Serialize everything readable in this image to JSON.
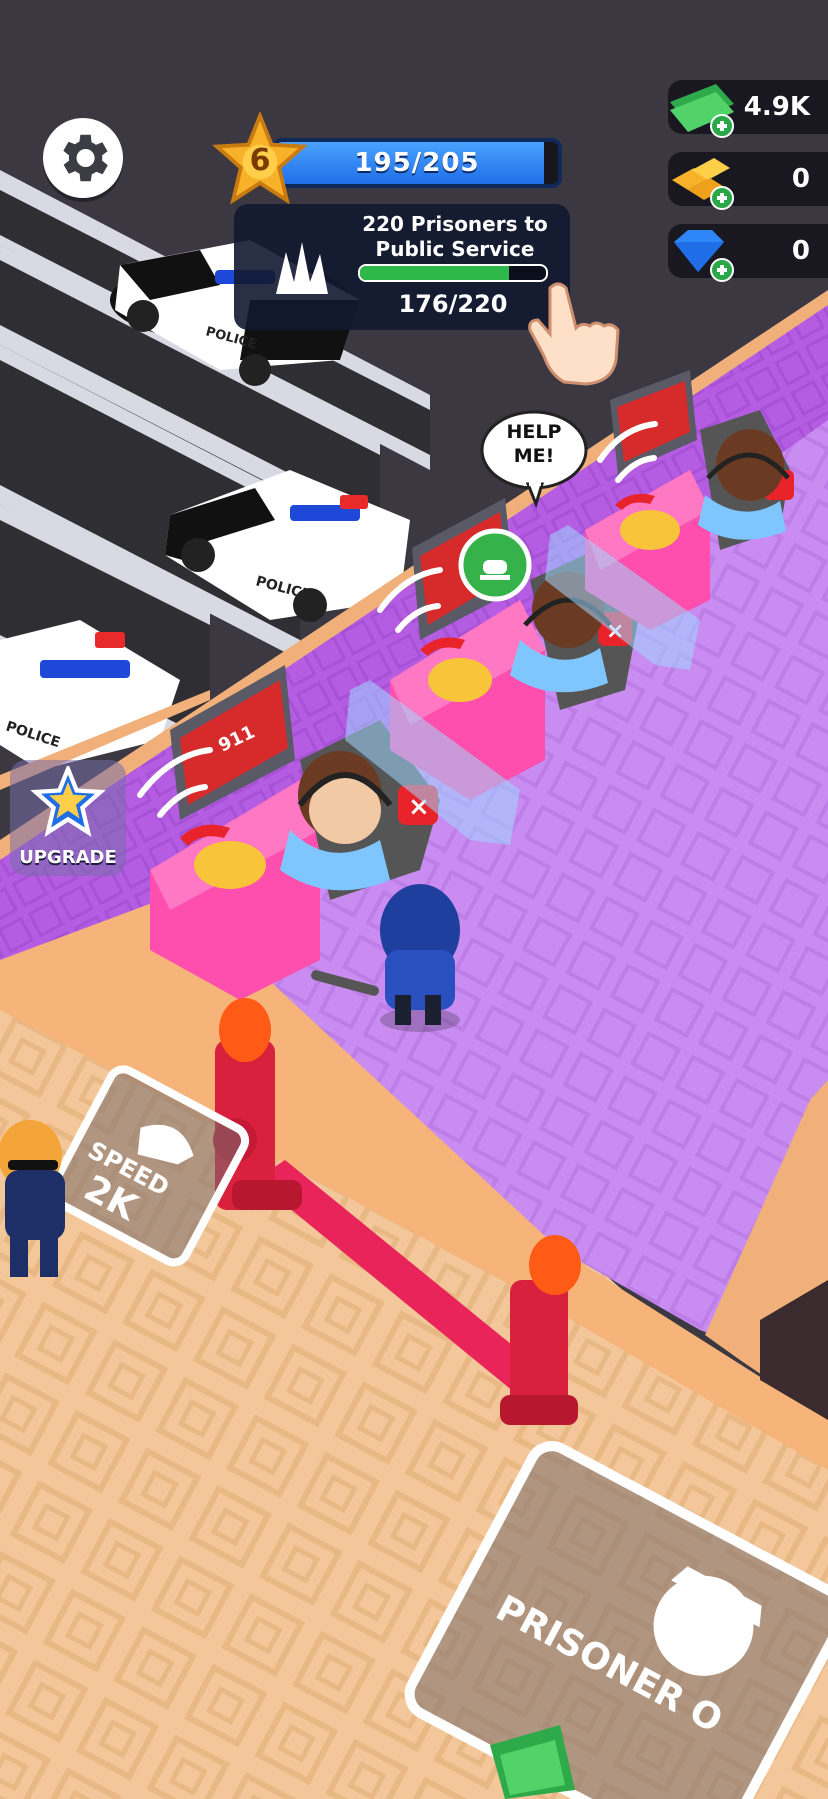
{
  "hud": {
    "level": "6",
    "xp_text": "195/205",
    "xp_progress": 0.951,
    "quest": {
      "title_line1": "220 Prisoners to",
      "title_line2": "Public Service",
      "count_text": "176/220",
      "progress": 0.8
    },
    "currencies": [
      {
        "name": "cash",
        "value": "4.9K",
        "icon": "cash-stack-icon"
      },
      {
        "name": "gold",
        "value": "0",
        "icon": "gold-bars-icon"
      },
      {
        "name": "gems",
        "value": "0",
        "icon": "diamond-icon"
      }
    ],
    "upgrade_label": "UPGRADE"
  },
  "world": {
    "help_bubble_line1": "HELP",
    "help_bubble_line2": "ME!",
    "monitor_label": "911",
    "car_label": "POLICE",
    "speed_tile_text": "SPEED",
    "speed_tile_cost": "2K",
    "prisoner_tile_text": "PRISONER O"
  },
  "colors": {
    "floor_purple": "#c98cf0",
    "wall_magenta": "#b05ce0",
    "tile_floor": "#f3c79a",
    "road": "#2e2e33",
    "xp_blue": "#2f86f6",
    "quest_green": "#2fb84a",
    "desk_pink": "#ff4fae"
  }
}
